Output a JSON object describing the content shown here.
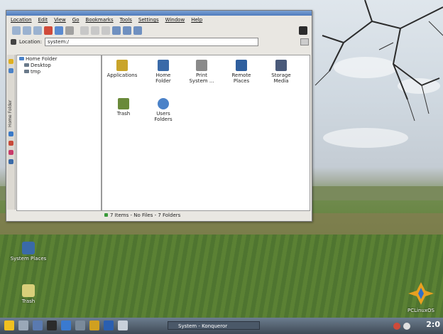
{
  "window": {
    "menu": [
      "Location",
      "Edit",
      "View",
      "Go",
      "Bookmarks",
      "Tools",
      "Settings",
      "Window",
      "Help"
    ],
    "location_label": "Location:",
    "location_value": "system:/",
    "tree": [
      "Home Folder",
      "Desktop",
      "tmp"
    ],
    "sidebar_tab_label": "Home Folder",
    "items": [
      {
        "label": "Applications",
        "icon": "applications-icon",
        "color": "#c9a42a"
      },
      {
        "label": "Home Folder",
        "icon": "home-folder-icon",
        "color": "#3a6aa8"
      },
      {
        "label": "Print System ...",
        "icon": "printer-icon",
        "color": "#8a8a8a"
      },
      {
        "label": "Remote Places",
        "icon": "remote-places-icon",
        "color": "#2f5f9e"
      },
      {
        "label": "Storage Media",
        "icon": "storage-media-icon",
        "color": "#4a5a7a"
      },
      {
        "label": "Trash",
        "icon": "trash-icon",
        "color": "#6a8a3a"
      },
      {
        "label": "Users Folders",
        "icon": "users-folders-icon",
        "color": "#4b82c8"
      }
    ],
    "status": "7 Items - No Files - 7 Folders"
  },
  "desktop_icons": [
    "System Places",
    "Trash"
  ],
  "taskbar": {
    "task_label": "System - Konqueror",
    "clock": "2:0"
  },
  "brand": "PCLinuxOS"
}
